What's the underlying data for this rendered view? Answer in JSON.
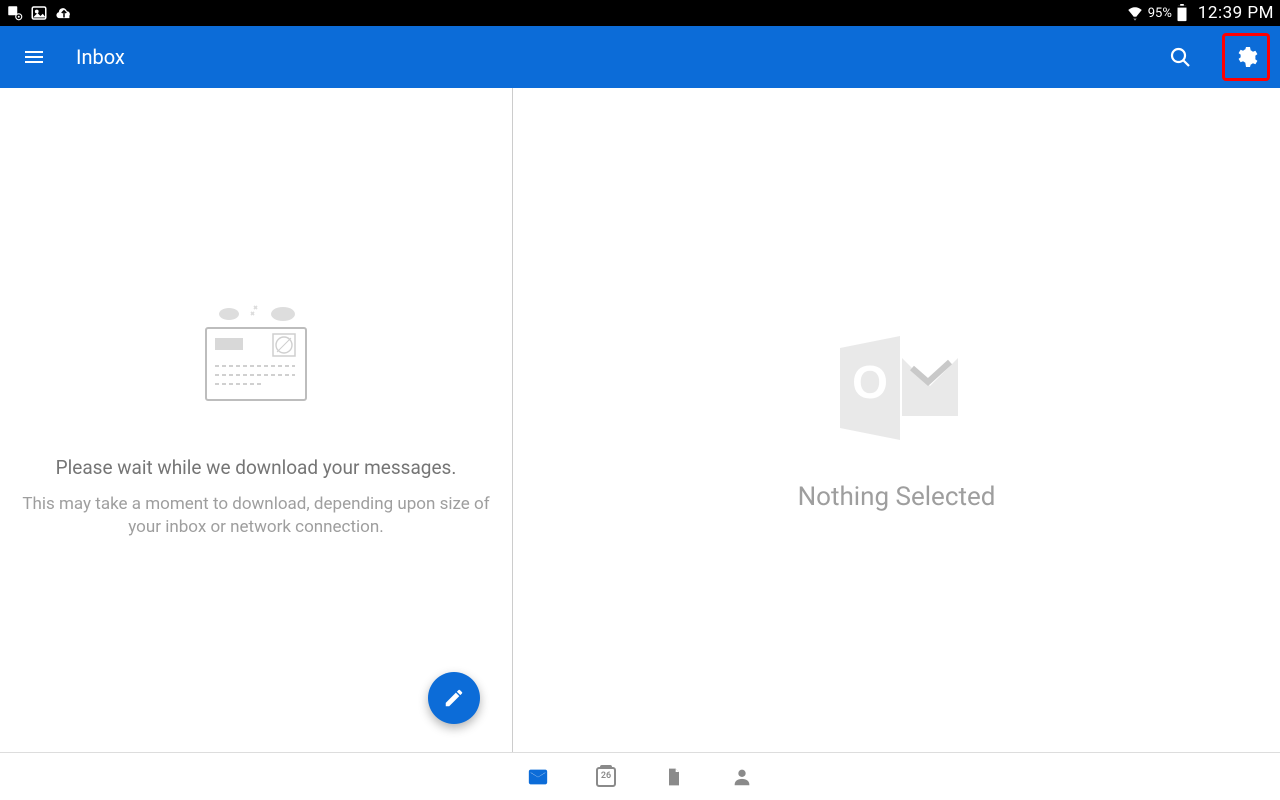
{
  "statusbar": {
    "battery_pct": "95%",
    "clock": "12:39 PM"
  },
  "appbar": {
    "title": "Inbox"
  },
  "left_pane": {
    "primary_text": "Please wait while we download your messages.",
    "secondary_text": "This may take a moment to download, depending upon size of your inbox or network connection."
  },
  "right_pane": {
    "empty_text": "Nothing Selected"
  },
  "bottomnav": {
    "calendar_day": "26"
  },
  "colors": {
    "brand": "#0c6cd8",
    "highlight": "#ff0000"
  }
}
